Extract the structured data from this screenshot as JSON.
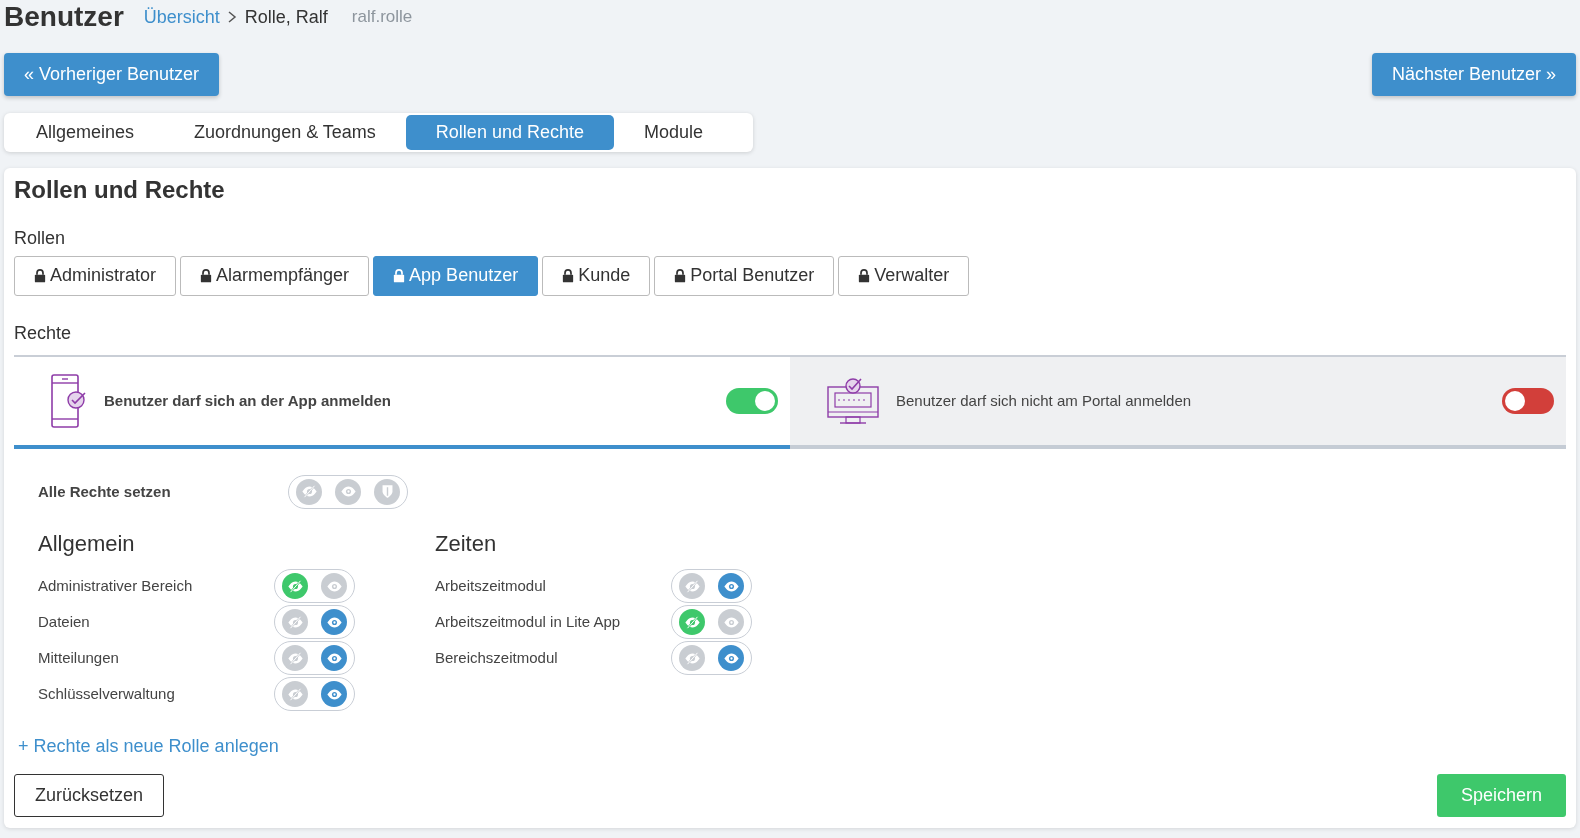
{
  "header": {
    "title": "Benutzer",
    "breadcrumb": [
      {
        "label": "Übersicht",
        "kind": "link"
      },
      {
        "label": "Rolle, Ralf",
        "kind": "current"
      },
      {
        "label": "ralf.rolle",
        "kind": "muted"
      }
    ]
  },
  "nav_buttons": {
    "previous": "« Vorheriger Benutzer",
    "next": "Nächster Benutzer »"
  },
  "tabs": [
    {
      "label": "Allgemeines",
      "selected": false
    },
    {
      "label": "Zuordnungen & Teams",
      "selected": false
    },
    {
      "label": "Rollen und Rechte",
      "selected": true
    },
    {
      "label": "Module",
      "selected": false
    }
  ],
  "panel": {
    "title": "Rollen und Rechte",
    "roles_label": "Rollen",
    "roles": [
      {
        "label": "Administrator",
        "selected": false
      },
      {
        "label": "Alarmempfänger",
        "selected": false
      },
      {
        "label": "App Benutzer",
        "selected": true
      },
      {
        "label": "Kunde",
        "selected": false
      },
      {
        "label": "Portal Benutzer",
        "selected": false
      },
      {
        "label": "Verwalter",
        "selected": false
      }
    ],
    "rights_label": "Rechte",
    "login_tabs": [
      {
        "kind": "app",
        "label": "Benutzer darf sich an der App anmelden",
        "selected": true,
        "on": true
      },
      {
        "kind": "portal",
        "label": "Benutzer darf sich nicht am Portal anmelden",
        "selected": false,
        "on": false
      }
    ],
    "set_all": {
      "label": "Alle Rechte setzen",
      "options": [
        {
          "kind": "hide",
          "selected": false
        },
        {
          "kind": "view",
          "selected": false
        },
        {
          "kind": "admin",
          "selected": false
        }
      ]
    },
    "groups": [
      {
        "title": "Allgemein",
        "rights": [
          {
            "label": "Administrativer Bereich",
            "options": [
              {
                "kind": "hide",
                "selected": true
              },
              {
                "kind": "view",
                "selected": false
              }
            ]
          },
          {
            "label": "Dateien",
            "options": [
              {
                "kind": "hide",
                "selected": false
              },
              {
                "kind": "view",
                "selected": true
              }
            ]
          },
          {
            "label": "Mitteilungen",
            "options": [
              {
                "kind": "hide",
                "selected": false
              },
              {
                "kind": "view",
                "selected": true
              }
            ]
          },
          {
            "label": "Schlüsselverwaltung",
            "options": [
              {
                "kind": "hide",
                "selected": false
              },
              {
                "kind": "view",
                "selected": true
              }
            ]
          }
        ]
      },
      {
        "title": "Zeiten",
        "rights": [
          {
            "label": "Arbeitszeitmodul",
            "options": [
              {
                "kind": "hide",
                "selected": false
              },
              {
                "kind": "view",
                "selected": true
              }
            ]
          },
          {
            "label": "Arbeitszeitmodul in Lite App",
            "options": [
              {
                "kind": "hide",
                "selected": true
              },
              {
                "kind": "view",
                "selected": false
              }
            ]
          },
          {
            "label": "Bereichszeitmodul",
            "options": [
              {
                "kind": "hide",
                "selected": false
              },
              {
                "kind": "view",
                "selected": true
              }
            ]
          }
        ]
      }
    ],
    "new_role_link": "+ Rechte als neue Rolle anlegen",
    "reset_button": "Zurücksetzen",
    "save_button": "Speichern"
  }
}
